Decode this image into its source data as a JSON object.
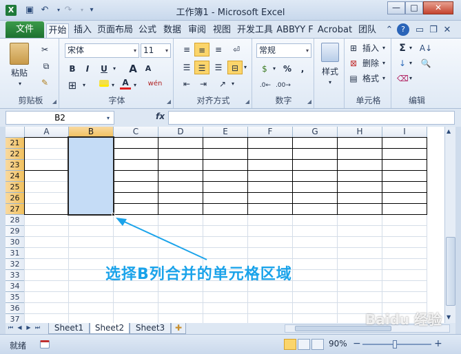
{
  "window": {
    "title": "工作簿1 - Microsoft Excel",
    "app_icon": "X",
    "min_label": "—",
    "max_label": "□",
    "close_label": "✕"
  },
  "quick_access": {
    "save_icon": "save-icon",
    "undo_icon": "undo-icon",
    "redo_icon": "redo-icon"
  },
  "tabs": {
    "file": "文件",
    "items": [
      "开始",
      "插入",
      "页面布局",
      "公式",
      "数据",
      "审阅",
      "视图",
      "开发工具",
      "ABBYY F",
      "Acrobat",
      "团队"
    ]
  },
  "ribbon": {
    "clipboard": {
      "paste": "粘贴",
      "label": "剪贴板"
    },
    "font": {
      "name": "宋体",
      "size": "11",
      "bold": "B",
      "italic": "I",
      "underline": "U",
      "grow": "A",
      "shrink": "A",
      "phonetic": "wén",
      "label": "字体"
    },
    "alignment": {
      "label": "对齐方式"
    },
    "number": {
      "format": "常规",
      "percent": "%",
      "comma": ",",
      "label": "数字"
    },
    "styles": {
      "label": "样式"
    },
    "cells": {
      "insert": "插入",
      "delete": "删除",
      "format": "格式",
      "label": "单元格"
    },
    "editing": {
      "sum": "Σ",
      "label": "编辑"
    }
  },
  "formula_bar": {
    "name_box": "B2",
    "fx": "fx",
    "content": ""
  },
  "columns": [
    "A",
    "B",
    "C",
    "D",
    "E",
    "F",
    "G",
    "H",
    "I"
  ],
  "rows": [
    "21",
    "22",
    "23",
    "24",
    "25",
    "26",
    "27",
    "28",
    "29",
    "30",
    "31",
    "32",
    "33",
    "34",
    "35",
    "36",
    "37"
  ],
  "selection": {
    "column": "B",
    "rows": [
      "21",
      "22",
      "23",
      "24",
      "25",
      "26",
      "27"
    ]
  },
  "sheets": [
    "Sheet1",
    "Sheet2",
    "Sheet3"
  ],
  "active_sheet": "Sheet2",
  "status": {
    "text": "就绪",
    "zoom": "90%",
    "zoom_out": "−",
    "zoom_in": "+"
  },
  "annotation": "选择B列合并的单元格区域",
  "colors": {
    "selection_fill": "#c5dcf6",
    "header_selected": "#f5cd7a",
    "accent_file": "#2a8a3e",
    "annotation": "#1aa3ea"
  }
}
